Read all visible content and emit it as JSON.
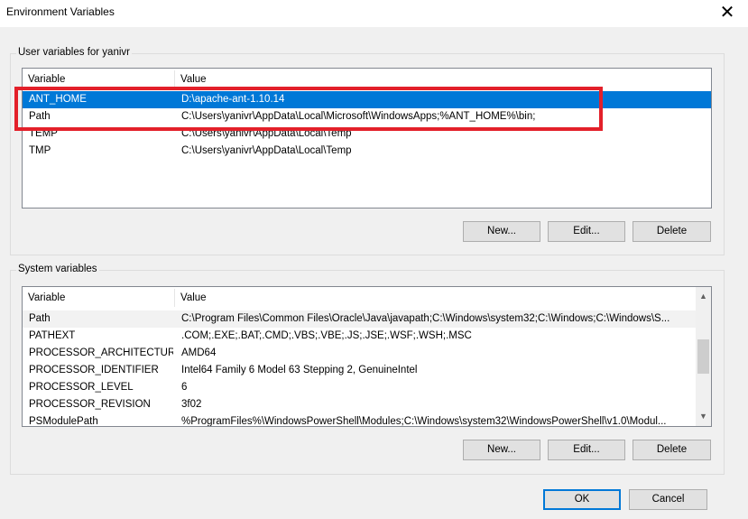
{
  "window": {
    "title": "Environment Variables",
    "close_glyph": "✕"
  },
  "user_section": {
    "label": "User variables for yanivr",
    "columns": [
      "Variable",
      "Value"
    ],
    "rows": [
      {
        "variable": "ANT_HOME",
        "value": "D:\\apache-ant-1.10.14"
      },
      {
        "variable": "Path",
        "value": "C:\\Users\\yanivr\\AppData\\Local\\Microsoft\\WindowsApps;%ANT_HOME%\\bin;"
      },
      {
        "variable": "TEMP",
        "value": "C:\\Users\\yanivr\\AppData\\Local\\Temp"
      },
      {
        "variable": "TMP",
        "value": "C:\\Users\\yanivr\\AppData\\Local\\Temp"
      }
    ],
    "buttons": {
      "new": "New...",
      "edit": "Edit...",
      "delete": "Delete"
    }
  },
  "system_section": {
    "label": "System variables",
    "columns": [
      "Variable",
      "Value"
    ],
    "rows": [
      {
        "variable": "Path",
        "value": "C:\\Program Files\\Common Files\\Oracle\\Java\\javapath;C:\\Windows\\system32;C:\\Windows;C:\\Windows\\S..."
      },
      {
        "variable": "PATHEXT",
        "value": ".COM;.EXE;.BAT;.CMD;.VBS;.VBE;.JS;.JSE;.WSF;.WSH;.MSC"
      },
      {
        "variable": "PROCESSOR_ARCHITECTURE",
        "value": "AMD64"
      },
      {
        "variable": "PROCESSOR_IDENTIFIER",
        "value": "Intel64 Family 6 Model 63 Stepping 2, GenuineIntel"
      },
      {
        "variable": "PROCESSOR_LEVEL",
        "value": "6"
      },
      {
        "variable": "PROCESSOR_REVISION",
        "value": "3f02"
      },
      {
        "variable": "PSModulePath",
        "value": "%ProgramFiles%\\WindowsPowerShell\\Modules;C:\\Windows\\system32\\WindowsPowerShell\\v1.0\\Modul..."
      }
    ],
    "buttons": {
      "new": "New...",
      "edit": "Edit...",
      "delete": "Delete"
    }
  },
  "dialog_buttons": {
    "ok": "OK",
    "cancel": "Cancel"
  },
  "colors": {
    "selection": "#0078d7",
    "annotation": "#e3202a"
  }
}
